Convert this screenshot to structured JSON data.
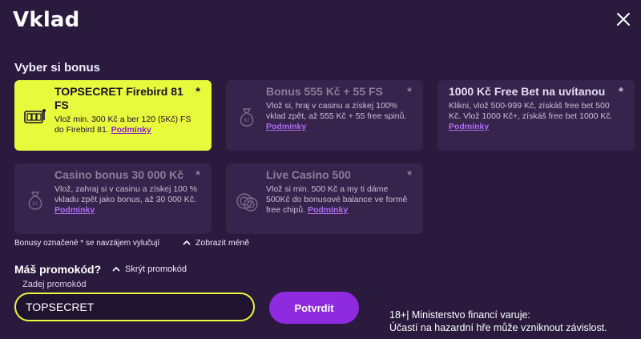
{
  "header": {
    "title": "Vklad"
  },
  "bonus_section": {
    "label": "Vyber si bonus"
  },
  "bonuses": [
    {
      "title": "TOPSECRET Firebird 81 FS",
      "description": "Vlož min. 300 Kč a ber 120 (5Kč) FS do Firebird 81.",
      "link": "Podmínky",
      "star": "*",
      "icon": "slot-machine-icon",
      "selected": true
    },
    {
      "title": "Bonus 555 Kč + 55 FS",
      "description": "Vlož si, hraj v casinu a získej 100% vklad zpět, až 555 Kč + 55 free spinů.",
      "link": "Podmínky",
      "star": "*",
      "icon": "money-bag-icon"
    },
    {
      "title": "1000 Kč Free Bet na uvítanou",
      "description": "Klikni, vlož 500-999 Kč, získáš free bet 500 Kč. Vlož 1000 Kč+, získáš free bet 1000 Kč.",
      "link": "Podmínky",
      "star": "*"
    },
    {
      "title": "Casino bonus 30 000 Kč",
      "description": "Vlož, zahraj si v casinu a získej 100 % vkladu zpět jako bonus, až 30 000 Kč.",
      "link": "Podmínky",
      "star": "*",
      "icon": "money-bag-icon"
    },
    {
      "title": "Live Casino 500",
      "description": "Vlož si min. 500 Kč a my ti dáme 500Kč do bonusové balance ve formě free chipů.",
      "link": "Podmínky",
      "star": "*",
      "icon": "casino-chips-icon"
    }
  ],
  "bonus_note": "Bonusy označené * se navzájem vylučují",
  "show_less": "Zobrazit méně",
  "promo": {
    "heading": "Máš promokód?",
    "toggle": "Skrýt promokód",
    "label": "Zadej promokód",
    "value": "TOPSECRET",
    "button": "Potvrdit"
  },
  "warning": {
    "line1": "18+| Ministerstvo financí varuje:",
    "line2": "Účastí na hazardní hře může vzniknout závislost."
  },
  "colors": {
    "background": "#2a1a3e",
    "card": "#36244d",
    "selected": "#e8fa3c",
    "accent": "#8e2be0",
    "link": "#b06cf0"
  }
}
